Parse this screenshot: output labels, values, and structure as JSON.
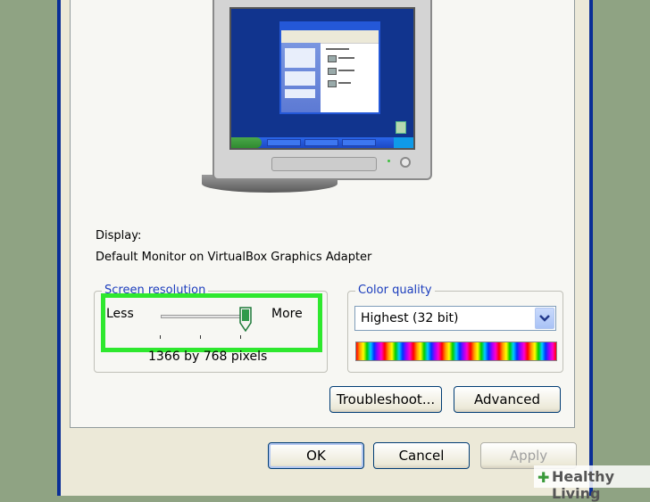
{
  "display": {
    "label": "Display:",
    "device": "Default Monitor on VirtualBox Graphics Adapter"
  },
  "screen_resolution": {
    "legend": "Screen resolution",
    "less_label": "Less",
    "more_label": "More",
    "value_text": "1366 by 768 pixels",
    "slider_position": 1.0
  },
  "color_quality": {
    "legend": "Color quality",
    "selected": "Highest (32 bit)"
  },
  "buttons": {
    "troubleshoot": "Troubleshoot...",
    "advanced": "Advanced",
    "ok": "OK",
    "cancel": "Cancel",
    "apply": "Apply"
  },
  "watermark": {
    "text": "Healthy Living"
  },
  "colors": {
    "highlight": "#2ee82e",
    "title_bar": "#0a2e96",
    "group_legend": "#1b3dbd"
  }
}
